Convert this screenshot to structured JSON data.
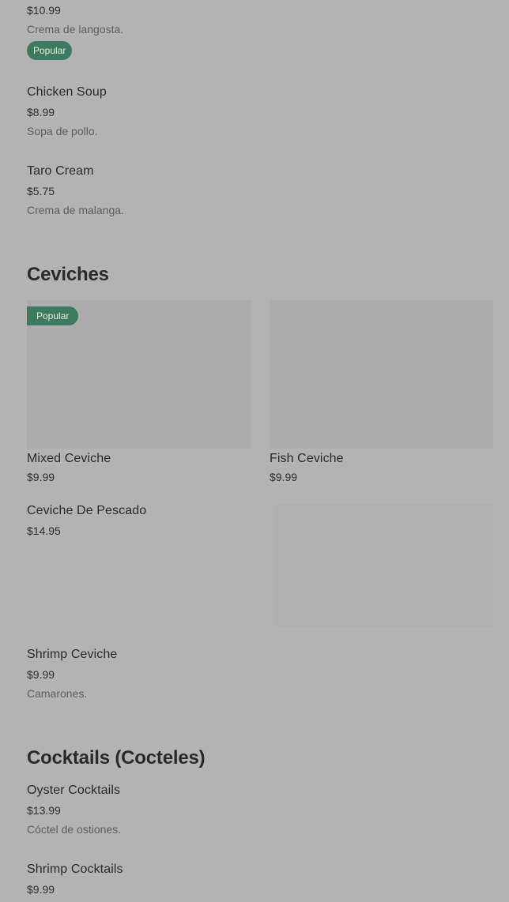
{
  "soups_partial": {
    "lobster": {
      "price": "$10.99",
      "desc": "Crema de langosta.",
      "badge": "Popular"
    },
    "chicken": {
      "name": "Chicken Soup",
      "price": "$8.99",
      "desc": "Sopa de pollo."
    },
    "taro": {
      "name": "Taro Cream",
      "price": "$5.75",
      "desc": "Crema de malanga."
    }
  },
  "ceviches": {
    "title": "Ceviches",
    "cards": [
      {
        "name": "Mixed Ceviche",
        "price": "$9.99",
        "badge": "Popular"
      },
      {
        "name": "Fish Ceviche",
        "price": "$9.99"
      }
    ],
    "rows": [
      {
        "name": "Ceviche De Pescado",
        "price": "$14.95"
      },
      {
        "name": "Shrimp Ceviche",
        "price": "$9.99",
        "desc": "Camarones."
      }
    ]
  },
  "cocktails": {
    "title": "Cocktails (Cocteles)",
    "items": [
      {
        "name": "Oyster Cocktails",
        "price": "$13.99",
        "desc": "Cóctel de ostiones."
      },
      {
        "name": "Shrimp Cocktails",
        "price": "$9.99"
      }
    ]
  },
  "colors": {
    "overlay_bg": "#b3b3b3",
    "badge_bg": "#3e7a5e",
    "image_placeholder": "#acacac"
  }
}
